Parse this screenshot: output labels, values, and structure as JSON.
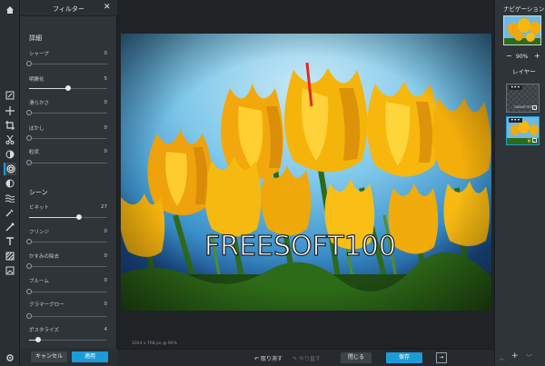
{
  "toolbar": {
    "tools": [
      "home-icon",
      "adjust-icon",
      "move-icon",
      "crop-icon",
      "cut-icon",
      "filter-brightness-icon",
      "filter-icon",
      "contrast-icon",
      "waves-icon",
      "eyedropper-icon",
      "brush-icon",
      "text-icon",
      "pattern-icon",
      "image-icon",
      "settings-icon"
    ],
    "active_tool": "filter-icon"
  },
  "filter_panel": {
    "title": "フィルター",
    "close": "✕",
    "section1": "詳細",
    "section2": "シーン",
    "sliders": [
      {
        "label": "シャープ",
        "value": "0",
        "level": 0
      },
      {
        "label": "明瞭化",
        "value": "5",
        "level": 0.5
      },
      {
        "label": "滑らかさ",
        "value": "0",
        "level": 0
      },
      {
        "label": "ぼかし",
        "value": "0",
        "level": 0
      },
      {
        "label": "粒状",
        "value": "0",
        "level": 0
      },
      {
        "label": "ビネット",
        "value": "27",
        "level": 0.64
      },
      {
        "label": "フリンジ",
        "value": "0",
        "level": 0
      },
      {
        "label": "かすみの除去",
        "value": "0",
        "level": 0
      },
      {
        "label": "ブルーム",
        "value": "0",
        "level": 0
      },
      {
        "label": "グラマーグロー",
        "value": "0",
        "level": 0
      },
      {
        "label": "ポスタライズ",
        "value": "4",
        "level": 0.12
      }
    ],
    "cancel": "キャンセル",
    "apply": "適用"
  },
  "canvas": {
    "watermark": "FREESOFT100",
    "status": "1024 x 768 px @ 90%"
  },
  "bottom_bar": {
    "undo": "↶ 取り消す",
    "redo": "↷ やり直す",
    "close": "閉じる",
    "save": "保存",
    "export": "⇥"
  },
  "right_panel": {
    "navigation_title": "ナビゲーション",
    "zoom_minus": "−",
    "zoom_level": "90%",
    "zoom_plus": "+",
    "layers_title": "レイヤー",
    "layer1_dots": "•••",
    "layer1_label": "UNSHIFTED",
    "layer2_dots": "•••",
    "layer_up": "︿",
    "layer_add": "+",
    "layer_down": "﹀"
  },
  "colors": {
    "accent": "#1e9bd7",
    "panel": "#2f3438",
    "background": "#1f2326"
  }
}
